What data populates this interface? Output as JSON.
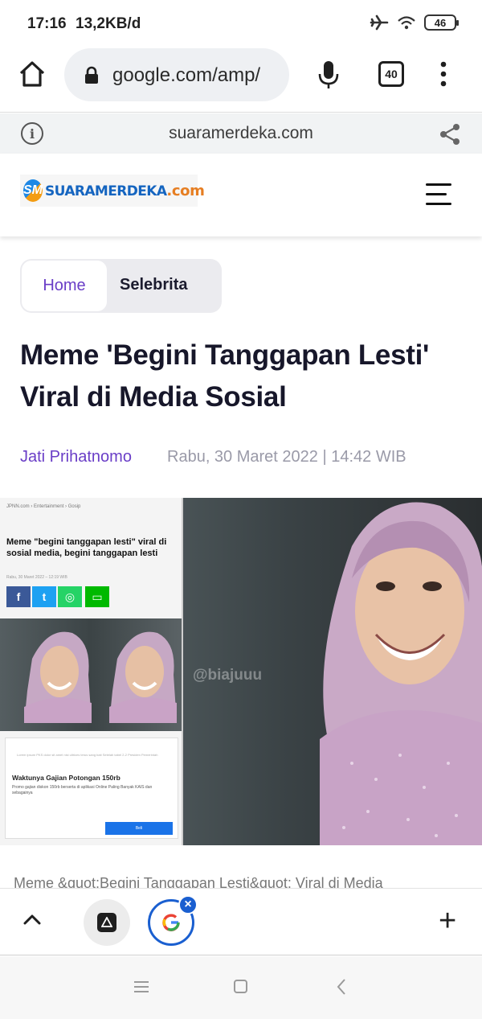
{
  "status_bar": {
    "time": "17:16",
    "speed": "13,2KB/d",
    "battery": "46"
  },
  "browser": {
    "url": "google.com/amp/",
    "tab_count": "40",
    "amp_domain": "suaramerdeka.com"
  },
  "site": {
    "logo_brand": "SUARAMERDEKA",
    "logo_tld": ".com",
    "logo_mark": "SM"
  },
  "breadcrumb": {
    "home": "Home",
    "current": "Selebrita"
  },
  "article": {
    "title": "Meme 'Begini Tanggapan Lesti' Viral di Media Sosial",
    "author": "Jati Prihatnomo",
    "date": "Rabu, 30 Maret 2022 | 14:42 WIB",
    "caption": "Meme &quot;Begini Tanggapan Lesti&quot; Viral di Media"
  },
  "image": {
    "watermark": "@biajuuu",
    "inner_breadcrumb": "JPNN.com › Entertainment › Gosip",
    "inner_title": "Meme \"begini tanggapan lesti\" viral di sosial media, begini tanggapan lesti",
    "inner_meta": "Rabu, 30 Maret 2022 – 12:19 WIB",
    "ad_blurb": "Lorem ipsum PKS dolor sit amet nisi ultrices terus sang bait Setelah tabel 2-2 Presiden Pemerintah",
    "ad_title": "Waktunya Gajian Potongan 150rb",
    "ad_body": "Promo gajian diskon 150rb berserta di aplikasi Online Paling Banyak KAIS dan sebagainya",
    "ad_button": "Beli"
  },
  "colors": {
    "accent_purple": "#6a3ec7",
    "tab_blue": "#1a5fd0",
    "logo_blue": "#1565c0",
    "logo_orange": "#e67e22"
  },
  "icons": [
    "home-icon",
    "lock-icon",
    "mic-icon",
    "tabs-icon",
    "overflow-menu-icon",
    "info-icon",
    "share-icon",
    "hamburger-icon",
    "chevron-up-icon",
    "close-icon",
    "plus-icon",
    "nav-menu-icon",
    "nav-home-icon",
    "nav-back-icon"
  ]
}
